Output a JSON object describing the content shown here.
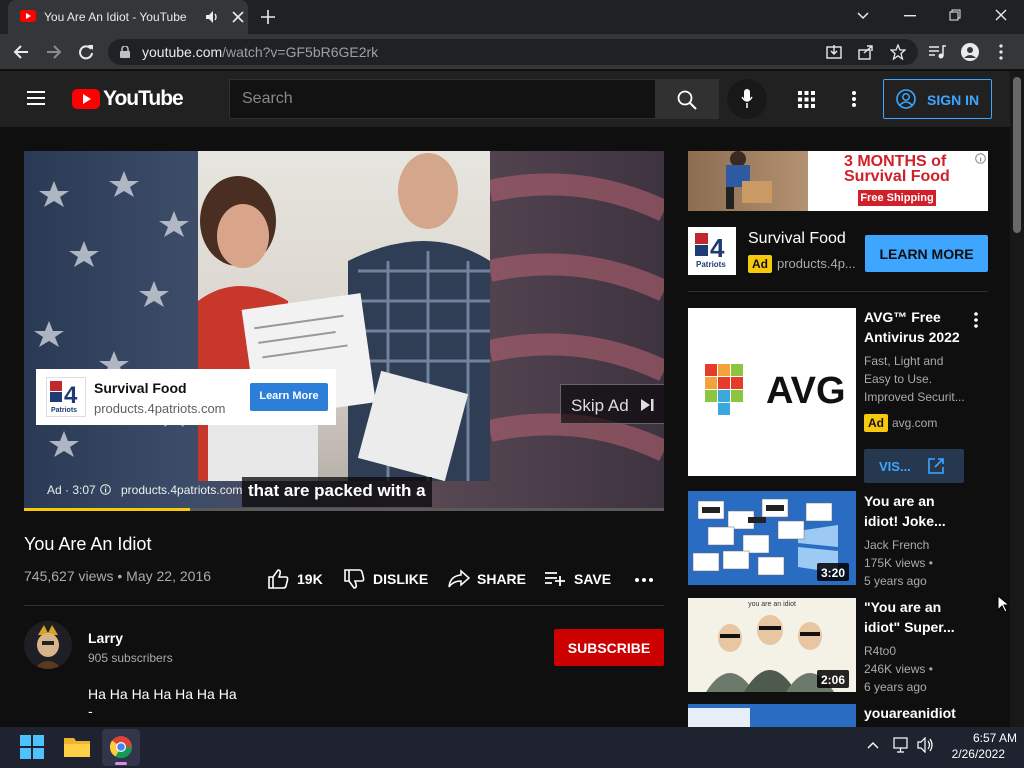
{
  "browser": {
    "tab_title": "You Are An Idiot - YouTube",
    "url_host": "youtube.com",
    "url_path": "/watch?v=GF5bR6GE2rk"
  },
  "header": {
    "logo_text": "YouTube",
    "search_placeholder": "Search",
    "signin_label": "SIGN IN"
  },
  "player": {
    "ad_card_title": "Survival Food",
    "ad_card_url": "products.4patriots.com",
    "ad_card_button": "Learn More",
    "skip_label": "Skip Ad",
    "ad_info": "Ad · 3:07",
    "ad_info_url": "products.4patriots.com",
    "caption": "that are packed with a",
    "progress": 0.26
  },
  "video": {
    "title": "You Are An Idiot",
    "views_date": "745,627 views • May 22, 2016",
    "like_count": "19K",
    "dislike_label": "DISLIKE",
    "share_label": "SHARE",
    "save_label": "SAVE"
  },
  "channel": {
    "name": "Larry",
    "subscribers": "905 subscribers",
    "subscribe_label": "SUBSCRIBE",
    "description": "Ha Ha Ha Ha Ha Ha Ha"
  },
  "sidebar_ad": {
    "banner_line1": "3 MONTHS of",
    "banner_line2": "Survival Food",
    "banner_tag": "Free Shipping",
    "title": "Survival Food",
    "badge": "Ad",
    "url": "products.4p...",
    "button": "LEARN MORE"
  },
  "avg_ad": {
    "logo_text": "AVG",
    "title_line1": "AVG™ Free",
    "title_line2": "Antivirus 2022",
    "desc_line1": "Fast, Light and",
    "desc_line2": "Easy to Use.",
    "desc_line3": "Improved Securit...",
    "badge": "Ad",
    "url": "avg.com",
    "visit_label": "VIS..."
  },
  "recommendations": [
    {
      "title_line1": "You are an",
      "title_line2": "idiot! Joke...",
      "channel": "Jack French",
      "views": "175K views •",
      "age": "5 years ago",
      "duration": "3:20"
    },
    {
      "title_line1": "\"You are an",
      "title_line2": "idiot\" Super...",
      "channel": "R4to0",
      "views": "246K views •",
      "age": "6 years ago",
      "duration": "2:06",
      "thumb_text": "you are an idiot"
    },
    {
      "title_line1": "youareanidiot"
    }
  ],
  "taskbar": {
    "time": "6:57 AM",
    "date": "2/26/2022"
  },
  "colors": {
    "accent_blue": "#3ea6ff",
    "subscribe_red": "#cc0000",
    "progress_yellow": "#f7c90e",
    "ad_badge_yellow": "#f7c90e"
  }
}
